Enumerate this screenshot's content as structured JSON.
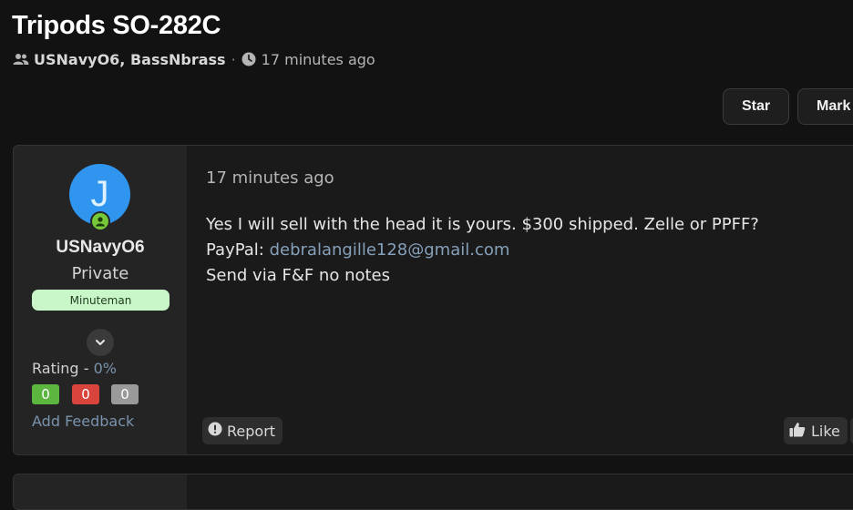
{
  "thread": {
    "title": "Tripods SO-282C",
    "participants": "USNavyO6, BassNbrass",
    "separator": "·",
    "time": "17 minutes ago"
  },
  "actions": {
    "star_label": "Star",
    "mark_label": "Mark"
  },
  "post": {
    "author": {
      "avatar_letter": "J",
      "avatar_color": "#2f95ef",
      "username": "USNavyO6",
      "rank": "Private",
      "badge": "Minuteman",
      "rating_label": "Rating",
      "rating_dash": "-",
      "rating_value": "0%",
      "positive_count": "0",
      "negative_count": "0",
      "neutral_count": "0",
      "feedback_link": "Add Feedback"
    },
    "time": "17 minutes ago",
    "lines": {
      "line1": "Yes I will sell with the head it is yours. $300 shipped. Zelle or PPFF?",
      "paypal_label": "PayPal: ",
      "paypal_email": "debralangille128@gmail.com",
      "line3": "Send via F&F no notes"
    },
    "report_label": "Report",
    "like_label": "Like"
  },
  "colors": {
    "background": "#121212",
    "link": "#86a0ba",
    "badge_bg": "#c9f7c9",
    "positive": "#5cb53f",
    "negative": "#d9453d",
    "neutral": "#9a9a9a"
  },
  "icons": {
    "participants": "users-icon",
    "time": "clock-icon",
    "online": "online-status-icon",
    "expand": "chevron-down-icon",
    "report": "alert-icon",
    "like": "thumbs-up-icon"
  }
}
